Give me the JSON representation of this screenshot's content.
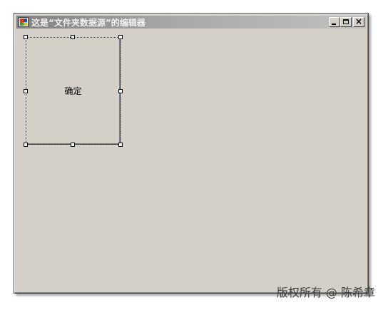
{
  "window": {
    "title": "这是“文件夹数据源”的编辑器",
    "minimize_label": "",
    "maximize_label": "",
    "close_label": "×"
  },
  "designer": {
    "ok_button_label": "确定"
  },
  "watermark": "版权所有 @ 陈希章",
  "colors": {
    "face": "#d4d0c8",
    "titlebar_inactive_start": "#808080",
    "titlebar_inactive_end": "#c0c0c0"
  }
}
